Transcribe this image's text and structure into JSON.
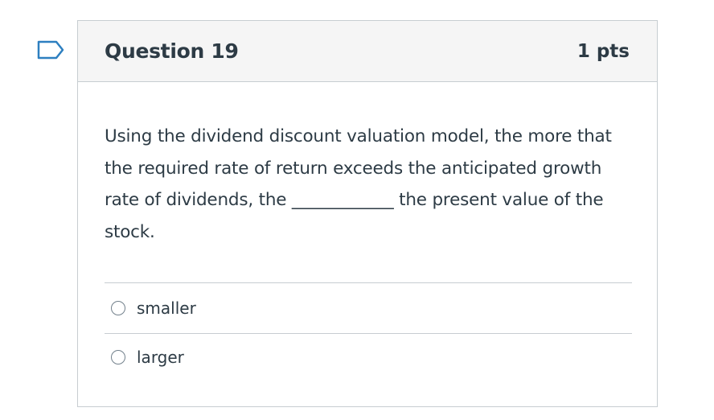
{
  "question": {
    "title": "Question 19",
    "points": "1 pts",
    "text": "Using the dividend discount valuation model, the more that the required rate of return exceeds the anticipated growth rate of dividends, the ____________ the present value of the stock."
  },
  "answers": [
    {
      "label": "smaller",
      "selected": false
    },
    {
      "label": "larger",
      "selected": false
    }
  ],
  "colors": {
    "flag": "#2d7fc0",
    "text": "#2d3b45",
    "header_bg": "#f5f5f5",
    "border": "#c7cdd1"
  },
  "icons": {
    "flag": "bookmark-flag-icon",
    "radio": "radio-button-icon"
  }
}
